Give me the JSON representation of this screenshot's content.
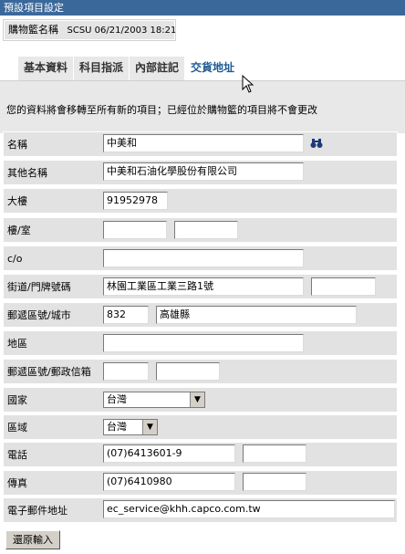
{
  "window": {
    "title": "預設項目設定"
  },
  "cart": {
    "label": "購物籃名稱",
    "value": "SCSU 06/21/2003 18:21"
  },
  "tabs": [
    {
      "label": "基本資料"
    },
    {
      "label": "科目指派"
    },
    {
      "label": "內部註記"
    },
    {
      "label": "交貨地址"
    }
  ],
  "notice": "您的資料將會移轉至所有新的項目；已經位於購物籃的項目將不會更改",
  "fields": {
    "name": {
      "label": "名稱",
      "value": "中美和"
    },
    "other_name": {
      "label": "其他名稱",
      "value": "中美和石油化學股份有限公司"
    },
    "building": {
      "label": "大樓",
      "value": "91952978"
    },
    "floor_room": {
      "label": "樓/室",
      "value1": "",
      "value2": ""
    },
    "co": {
      "label": "c/o",
      "value": ""
    },
    "street": {
      "label": "街道/門牌號碼",
      "value1": "林園工業區工業三路1號",
      "value2": ""
    },
    "postal_city": {
      "label": "郵遞區號/城市",
      "postal": "832",
      "city": "高雄縣"
    },
    "region": {
      "label": "地區",
      "value": ""
    },
    "postal_pobox": {
      "label": "郵遞區號/郵政信箱",
      "value1": "",
      "value2": ""
    },
    "country": {
      "label": "國家",
      "value": "台灣"
    },
    "area": {
      "label": "區域",
      "value": "台灣"
    },
    "phone": {
      "label": "電話",
      "value1": "(07)6413601-9",
      "value2": ""
    },
    "fax": {
      "label": "傳真",
      "value1": "(07)6410980",
      "value2": ""
    },
    "email": {
      "label": "電子郵件地址",
      "value": "ec_service@khh.capco.com.tw"
    }
  },
  "buttons": {
    "reset": "還原輸入"
  }
}
